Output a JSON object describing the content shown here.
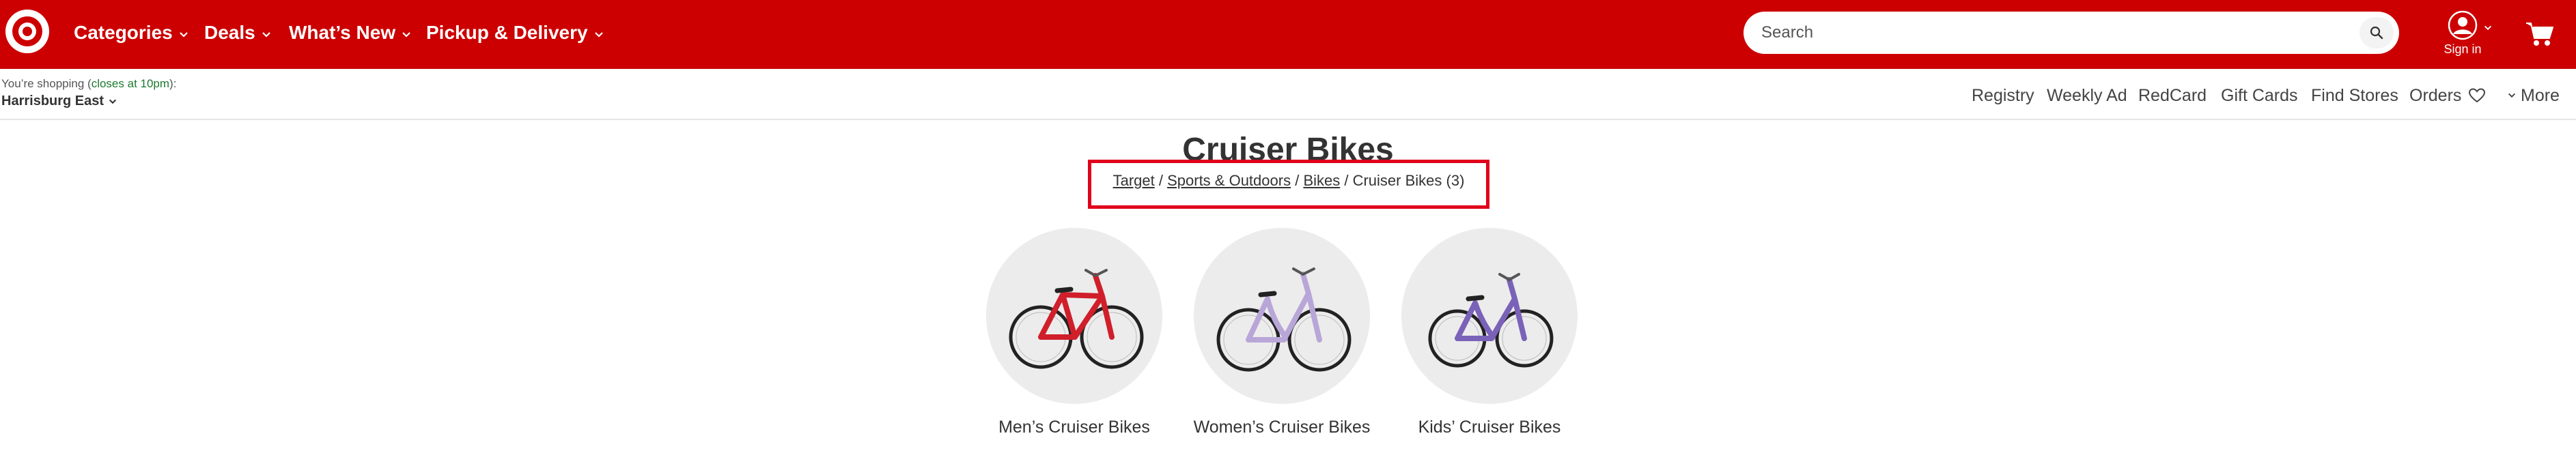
{
  "header": {
    "nav": [
      {
        "label": "Categories"
      },
      {
        "label": "Deals"
      },
      {
        "label": "What’s New"
      },
      {
        "label": "Pickup & Delivery"
      }
    ],
    "search": {
      "placeholder": "Search"
    },
    "signin_label": "Sign in",
    "brand_color": "#cc0000"
  },
  "subbar": {
    "shopping_prefix": "You’re shopping (",
    "shopping_hours": "closes at 10pm",
    "shopping_suffix": "):",
    "store_name": "Harrisburg East",
    "links": [
      "Registry",
      "Weekly Ad",
      "RedCard",
      "Gift Cards",
      "Find Stores",
      "Orders"
    ],
    "more_label": "More"
  },
  "main": {
    "title": "Cruiser Bikes",
    "breadcrumb": {
      "links": [
        "Target",
        "Sports & Outdoors",
        "Bikes"
      ],
      "current": "Cruiser Bikes (3)"
    },
    "categories": [
      {
        "label": "Men’s Cruiser Bikes",
        "frame_color": "#d01f2a"
      },
      {
        "label": "Women’s Cruiser Bikes",
        "frame_color": "#b9a6d8"
      },
      {
        "label": "Kids’ Cruiser Bikes",
        "frame_color": "#7a62b8"
      }
    ]
  }
}
